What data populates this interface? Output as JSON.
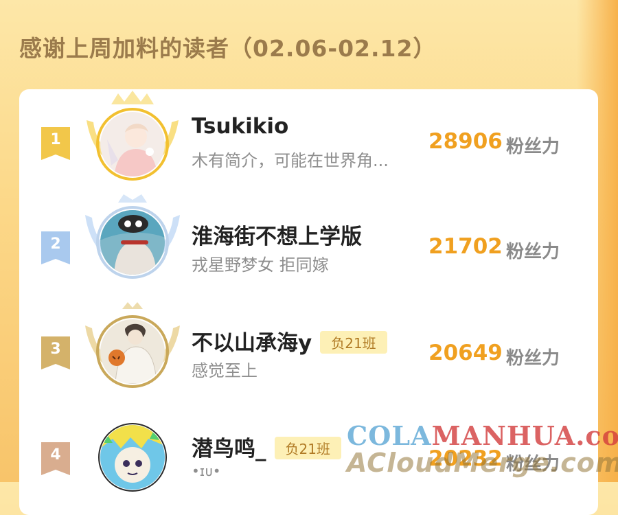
{
  "header": {
    "title": "感谢上周加料的读者（02.06-02.12）"
  },
  "colors": {
    "gold": "#f2c74a",
    "silver": "#a9c9ee",
    "bronze": "#d4b26a",
    "copper": "#d9ad8f",
    "score": "#f0a020"
  },
  "ranking": [
    {
      "rank": "1",
      "name": "Tsukikio",
      "bio": "木有简介，可能在世界角...",
      "tag": "",
      "score": "28906",
      "unit": "粉丝力"
    },
    {
      "rank": "2",
      "name": "淮海街不想上学版",
      "bio": "戎星野梦女 拒同嫁",
      "tag": "",
      "score": "21702",
      "unit": "粉丝力"
    },
    {
      "rank": "3",
      "name": "不以山承海y",
      "bio": "感觉至上",
      "tag": "负21班",
      "score": "20649",
      "unit": "粉丝力"
    },
    {
      "rank": "4",
      "name": "潜鸟鸣_",
      "bio": "•ɪᴜ•",
      "tag": "负21班",
      "score": "20232",
      "unit": "粉丝力"
    }
  ],
  "watermark": {
    "line1_a": "COLA",
    "line1_b": "MANHUA.com",
    "line2": "ACloudMerge.com"
  }
}
